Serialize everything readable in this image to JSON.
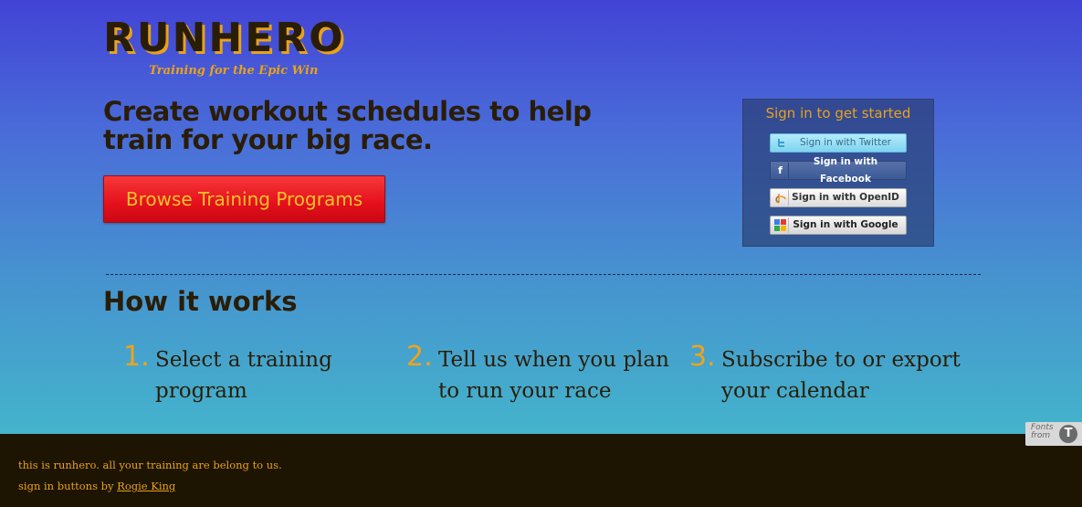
{
  "brand": {
    "logo": "RUNHERO",
    "tagline": "Training for the Epic Win"
  },
  "hero": {
    "headline": "Create workout schedules to help train for your big race.",
    "browse_button": "Browse Training Programs"
  },
  "signin": {
    "title": "Sign in to get started",
    "twitter": "Sign in with Twitter",
    "facebook": "Sign in with Facebook",
    "openid": "Sign in with OpenID",
    "google": "Sign in with Google"
  },
  "how_it_works": {
    "title": "How it works",
    "steps": [
      {
        "num": "1.",
        "text": "Select a training program"
      },
      {
        "num": "2.",
        "text": "Tell us when you plan to run your race"
      },
      {
        "num": "3.",
        "text": "Subscribe to or export your calendar"
      }
    ]
  },
  "footer": {
    "line1": "this is runhero. all your training are belong to us.",
    "line2_prefix": "sign in buttons by",
    "line2_link": "Rogie King"
  },
  "fonts_badge": {
    "text": "Fonts from",
    "icon": "typekit-icon"
  },
  "colors": {
    "accent": "#e8a21b",
    "dark": "#2a1d08",
    "button_red": "#e4101c",
    "footer_bg": "#1d1402"
  }
}
